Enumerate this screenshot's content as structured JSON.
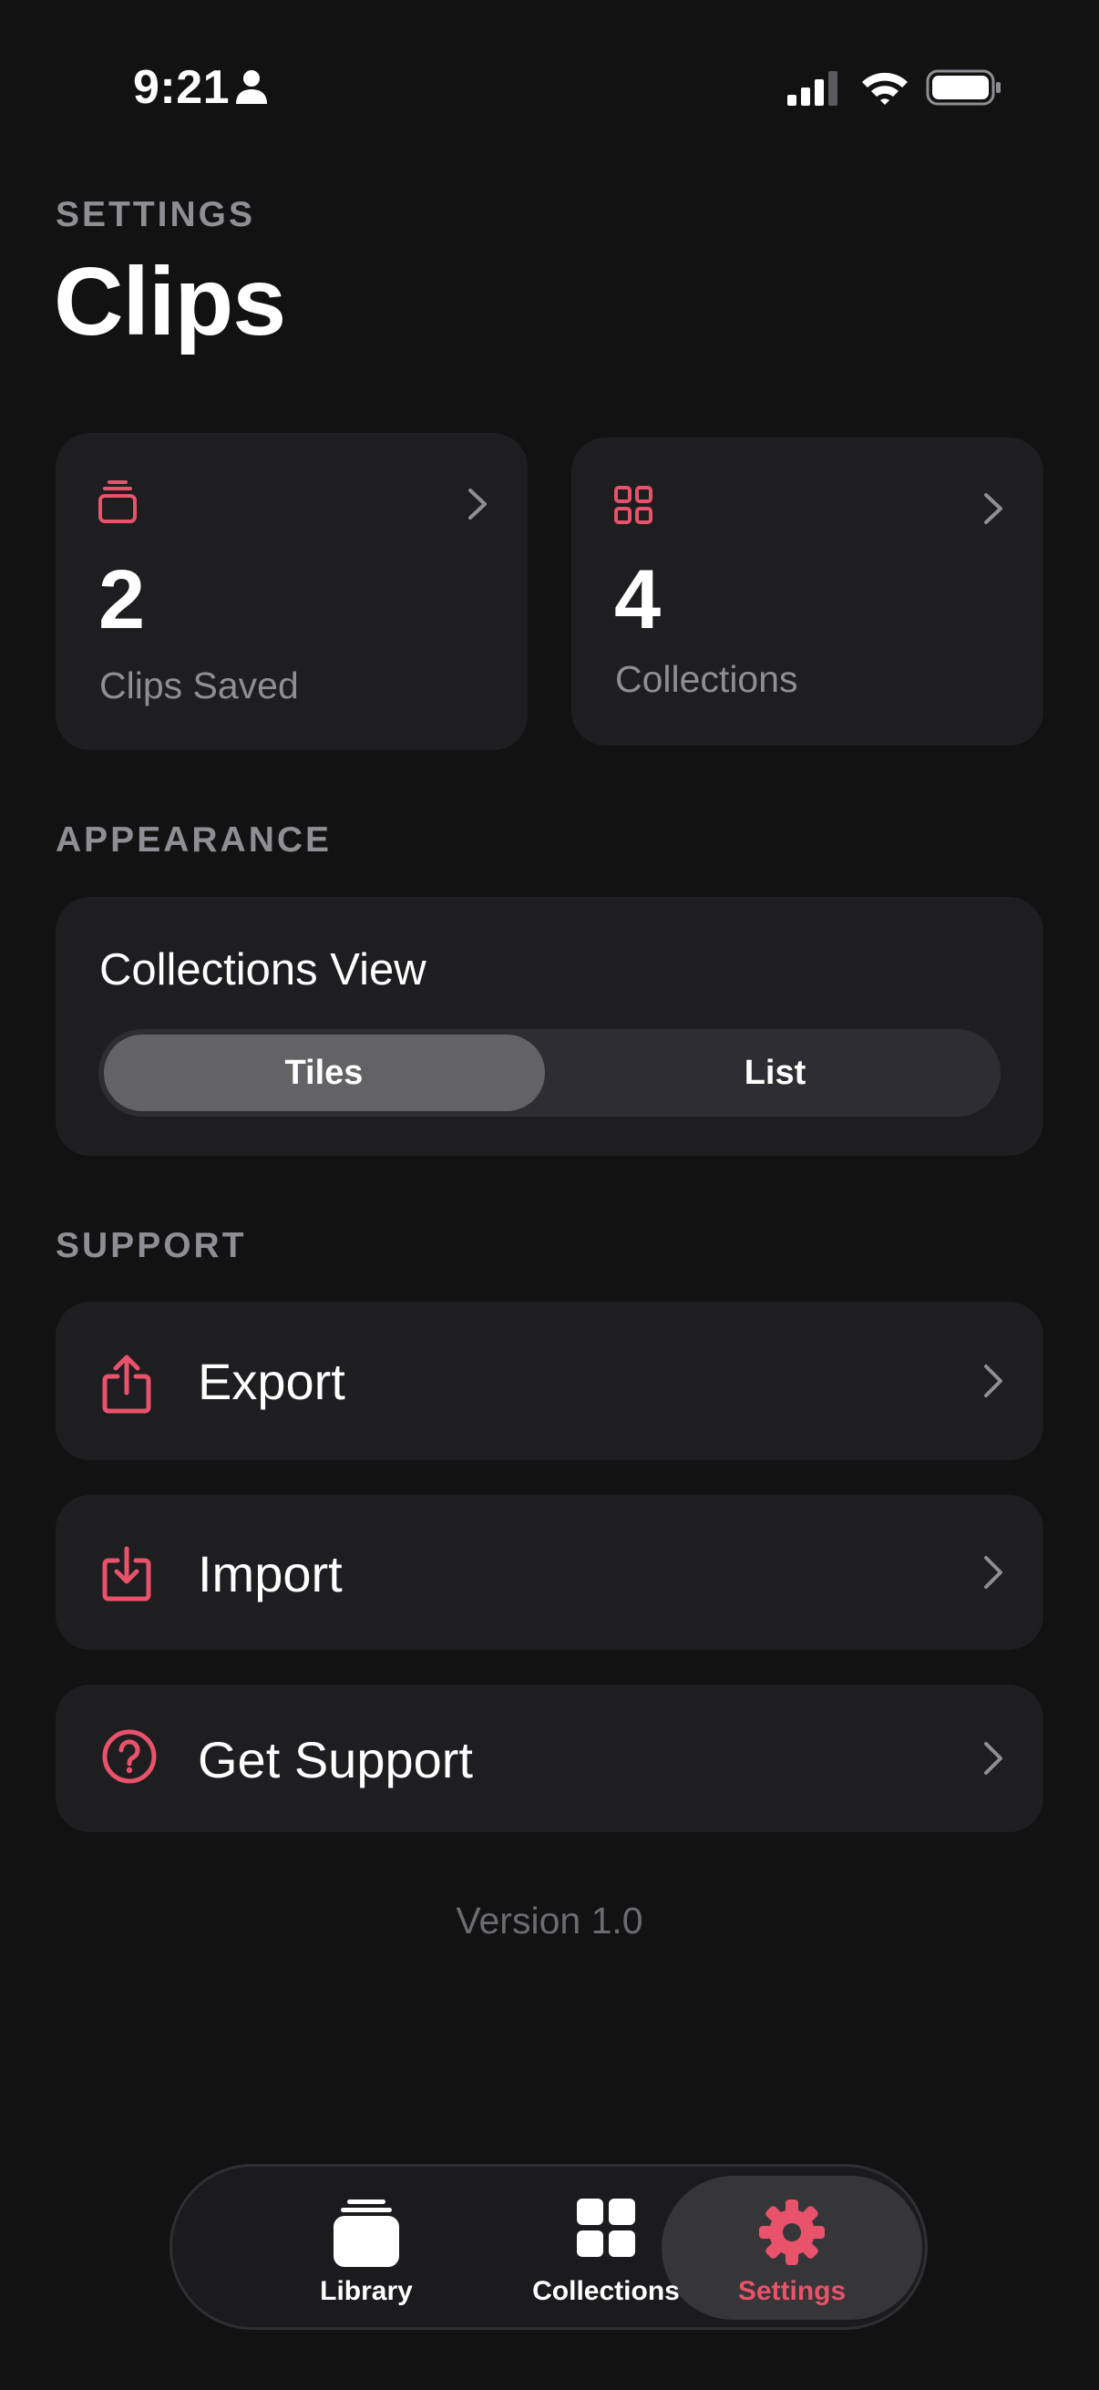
{
  "status_bar": {
    "time": "9:21"
  },
  "header": {
    "eyebrow": "SETTINGS",
    "title": "Clips"
  },
  "stats": [
    {
      "value": "2",
      "label": "Clips Saved",
      "icon": "stack-icon"
    },
    {
      "value": "4",
      "label": "Collections",
      "icon": "grid-icon"
    }
  ],
  "appearance": {
    "section_label": "APPEARANCE",
    "title": "Collections View",
    "options": [
      "Tiles",
      "List"
    ],
    "selected": "Tiles"
  },
  "support": {
    "section_label": "SUPPORT",
    "items": [
      {
        "label": "Export",
        "icon": "share-icon"
      },
      {
        "label": "Import",
        "icon": "download-icon"
      },
      {
        "label": "Get Support",
        "icon": "question-icon"
      }
    ]
  },
  "version": "Version 1.0",
  "tabbar": {
    "tabs": [
      {
        "label": "Library",
        "icon": "library-icon"
      },
      {
        "label": "Collections",
        "icon": "grid-icon"
      },
      {
        "label": "Settings",
        "icon": "gear-icon"
      }
    ],
    "selected": "Settings"
  },
  "colors": {
    "accent": "#E8526A",
    "background": "#121213",
    "card": "#1E1E21",
    "muted": "#8E8E93"
  }
}
